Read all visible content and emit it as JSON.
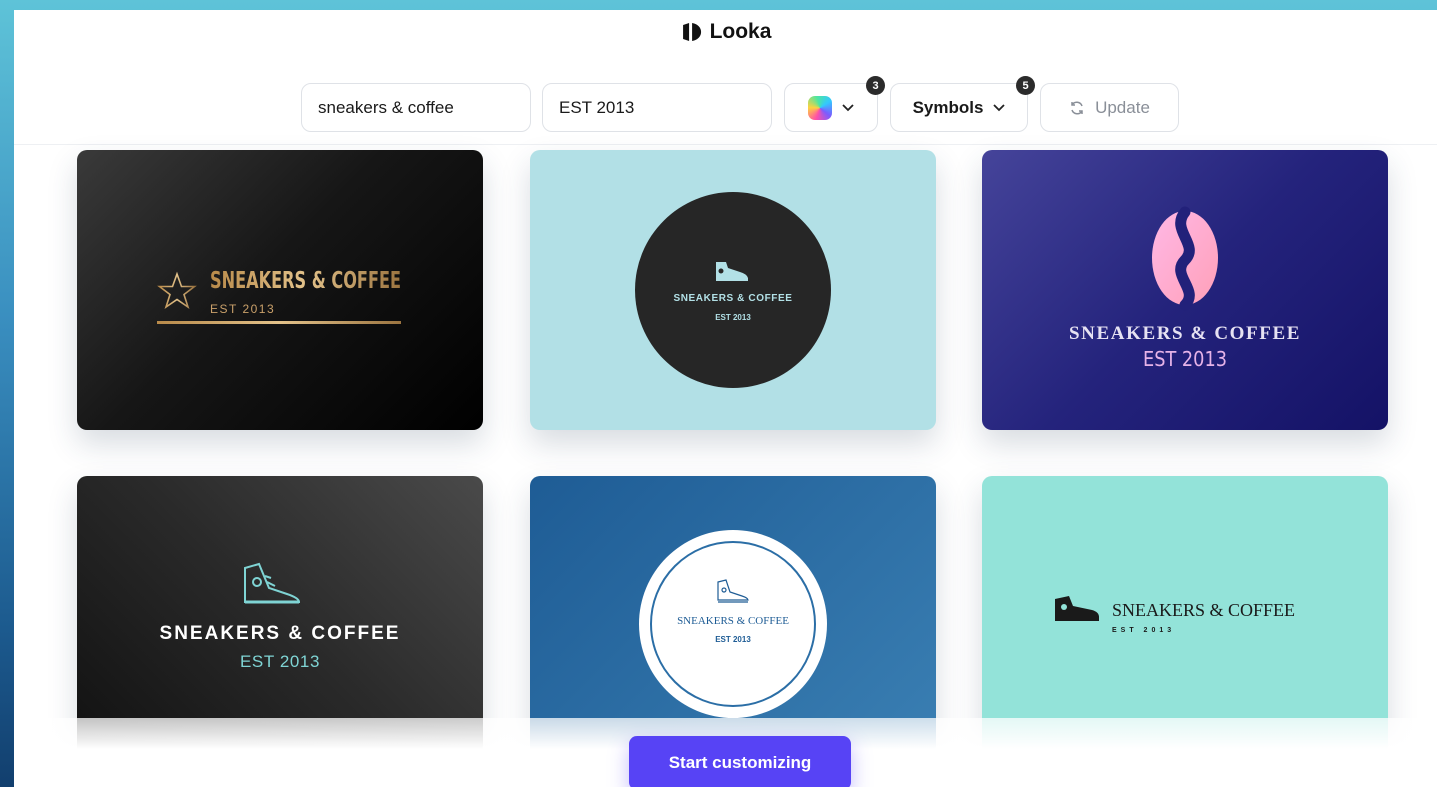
{
  "app": {
    "name": "Looka"
  },
  "toolbar": {
    "business_name_value": "sneakers & coffee",
    "slogan_value": "EST 2013",
    "colors_badge": "3",
    "symbols_label": "Symbols",
    "symbols_badge": "5",
    "update_label": "Update"
  },
  "logos": [
    {
      "name": "SNEAKERS & COFFEE",
      "tagline": "EST 2013",
      "icon": "star-icon",
      "colors": {
        "bg": "#0f0f0f",
        "text": "#c9a06a"
      }
    },
    {
      "name": "SNEAKERS & COFFEE",
      "tagline": "EST 2013",
      "icon": "sneaker-icon",
      "colors": {
        "bg": "#b2e0e6",
        "text": "#b2e0e6"
      }
    },
    {
      "name": "SNEAKERS & COFFEE",
      "tagline": "EST 2013",
      "icon": "coffee-bean-icon",
      "colors": {
        "bg": "#22217a",
        "text": "#e6b3e8"
      }
    },
    {
      "name": "SNEAKERS & COFFEE",
      "tagline": "EST 2013",
      "icon": "high-top-sneaker-icon",
      "colors": {
        "bg": "#262626",
        "text": "#7fd4d4"
      }
    },
    {
      "name": "SNEAKERS & COFFEE",
      "tagline": "EST 2013",
      "icon": "sneaker-icon",
      "colors": {
        "bg": "#2b6ea6",
        "text": "#1e5c95"
      }
    },
    {
      "name": "SNEAKERS & COFFEE",
      "tagline": "EST 2013",
      "icon": "sneaker-icon",
      "colors": {
        "bg": "#93e3d9",
        "text": "#1a1a1a"
      }
    }
  ],
  "cta": {
    "label": "Start customizing"
  },
  "colors": {
    "accent": "#5743f5"
  }
}
